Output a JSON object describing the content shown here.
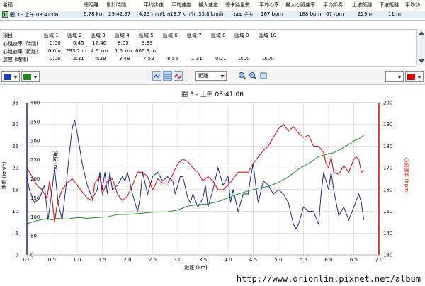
{
  "lap_table": {
    "headers": [
      "名稱",
      "總距離",
      "累計時間",
      "平均步速",
      "平均速度",
      "最大速度",
      "總卡路里數",
      "平均心率",
      "最大心跳速率",
      "平均節奏",
      "上坡距離",
      "下坡距離",
      "平均功"
    ],
    "row": [
      "圈 3 - 上午 08:41:06",
      "6.78 km",
      "29:42.97",
      "4:23 min/km",
      "13.7 km/h",
      "33.8 km/h",
      "344 千卡",
      "167 bpm",
      "188 bpm",
      "67 rpm",
      "229 m",
      "11 m",
      ""
    ]
  },
  "zone_table": {
    "headers": [
      "項目",
      "區域 1",
      "區域 2",
      "區域 3",
      "區域 4",
      "區域 5",
      "區域 6",
      "區域 7",
      "區域 8",
      "區域 9",
      "區域 10"
    ],
    "rows": [
      [
        "心跳速率 (時間)",
        "0:00",
        "0:45",
        "17:46",
        "8:05",
        "3:39",
        "",
        "",
        "",
        "",
        ""
      ],
      [
        "心跳速率 (距離)",
        "0.0 m",
        "293.2 m",
        "4.6 km",
        "1.6 km",
        "606.3 m",
        "",
        "",
        "",
        "",
        ""
      ],
      [
        "速度 (時間)",
        "0:00",
        "2:31",
        "4:29",
        "3:49",
        "7:52",
        "8:55",
        "1:31",
        "0:21",
        "0:00",
        "0:00"
      ]
    ]
  },
  "toolbar": {
    "left_color_1": "#1a3fbf",
    "left_color_2": "#1c8a1c",
    "right_color_1": "#ffffff",
    "right_color_2": "#e00000",
    "axis_select": "距離",
    "icons": [
      "chart-type-1-icon",
      "chart-type-2-icon",
      "chart-type-3-icon",
      "zoom-in-icon",
      "zoom-out-icon",
      "zoom-fit-icon"
    ]
  },
  "chart_data": {
    "type": "line",
    "title": "圈 3 - 上午 08:41:06",
    "xlabel": "距離 (km)",
    "xlim": [
      0,
      7
    ],
    "xticks": [
      "0.0",
      "0.5",
      "1.0",
      "1.5",
      "2.0",
      "2.5",
      "3.0",
      "3.5",
      "4.0",
      "4.5",
      "5.0",
      "5.5",
      "6.0",
      "6.5",
      "7.0"
    ],
    "axes": [
      {
        "label": "速度 (km/h)",
        "side": "left-outer",
        "lim": [
          0,
          35
        ],
        "ticks": [
          "0",
          "5",
          "10",
          "15",
          "20",
          "25",
          "30",
          "35"
        ],
        "color": "#1a2a8c"
      },
      {
        "label": "海拔 (m)",
        "side": "left-inner",
        "lim": [
          0,
          400
        ],
        "ticks": [
          "0",
          "50",
          "100",
          "150",
          "200",
          "250",
          "300",
          "350",
          "400"
        ],
        "color": "#1c8a1c"
      },
      {
        "label": "心跳速率 (bpm)",
        "side": "right",
        "lim": [
          130,
          200
        ],
        "ticks": [
          "130",
          "140",
          "150",
          "160",
          "170",
          "180",
          "190",
          "200"
        ],
        "color": "#e00000"
      }
    ],
    "grid": true,
    "series": [
      {
        "axis": 0,
        "color": "#1a2a8c",
        "x": [
          0.0,
          0.05,
          0.15,
          0.25,
          0.35,
          0.42,
          0.5,
          0.55,
          0.62,
          0.7,
          0.78,
          0.85,
          0.9,
          0.95,
          1.0,
          1.1,
          1.2,
          1.3,
          1.4,
          1.45,
          1.5,
          1.55,
          1.6,
          1.65,
          1.7,
          1.8,
          1.9,
          1.95,
          2.0,
          2.1,
          2.2,
          2.25,
          2.3,
          2.4,
          2.5,
          2.6,
          2.7,
          2.8,
          2.9,
          2.95,
          3.0,
          3.05,
          3.1,
          3.2,
          3.25,
          3.3,
          3.4,
          3.5,
          3.55,
          3.6,
          3.7,
          3.8,
          3.9,
          4.0,
          4.05,
          4.1,
          4.2,
          4.3,
          4.4,
          4.45,
          4.5,
          4.55,
          4.6,
          4.7,
          4.8,
          4.9,
          5.0,
          5.1,
          5.2,
          5.3,
          5.35,
          5.4,
          5.5,
          5.6,
          5.7,
          5.8,
          5.85,
          5.9,
          5.95,
          6.0,
          6.05,
          6.1,
          6.2,
          6.3,
          6.4,
          6.5,
          6.6,
          6.65,
          6.7
        ],
        "y": [
          18,
          15,
          12,
          13,
          16,
          8,
          15,
          20,
          12,
          8,
          16,
          24,
          29,
          31,
          28,
          21,
          16,
          13,
          15,
          19,
          15,
          19,
          14,
          19,
          15,
          16,
          18,
          17,
          19,
          14,
          10,
          13,
          19,
          14,
          18,
          19,
          17,
          18,
          17,
          14,
          16,
          18,
          18,
          13,
          12,
          14,
          11,
          13,
          16,
          11,
          15,
          20,
          16,
          18,
          12,
          15,
          10,
          14,
          14,
          18,
          21,
          16,
          12,
          17,
          16,
          14,
          15,
          14,
          12,
          7,
          6,
          7,
          11,
          10,
          10,
          7,
          14,
          19,
          17,
          15,
          19,
          15,
          9,
          11,
          8,
          11,
          14,
          12,
          8
        ]
      },
      {
        "axis": 1,
        "color": "#1c8a1c",
        "x": [
          0.0,
          0.2,
          0.4,
          0.5,
          0.6,
          0.8,
          1.0,
          1.2,
          1.4,
          1.6,
          1.8,
          2.0,
          2.2,
          2.5,
          2.8,
          3.0,
          3.2,
          3.4,
          3.6,
          3.8,
          4.0,
          4.2,
          4.4,
          4.6,
          4.8,
          5.0,
          5.2,
          5.4,
          5.6,
          5.8,
          6.0,
          6.1,
          6.2,
          6.4,
          6.5,
          6.6,
          6.7
        ],
        "y": [
          82,
          90,
          95,
          92,
          96,
          94,
          98,
          96,
          98,
          100,
          106,
          106,
          108,
          112,
          113,
          118,
          128,
          132,
          134,
          140,
          150,
          160,
          168,
          175,
          180,
          190,
          205,
          225,
          240,
          258,
          266,
          268,
          275,
          290,
          300,
          305,
          315
        ]
      },
      {
        "axis": 2,
        "color": "#e00000",
        "x": [
          0.0,
          0.1,
          0.2,
          0.3,
          0.4,
          0.45,
          0.5,
          0.55,
          0.6,
          0.7,
          0.8,
          0.9,
          1.0,
          1.1,
          1.2,
          1.3,
          1.35,
          1.45,
          1.5,
          1.6,
          1.7,
          1.8,
          1.9,
          2.0,
          2.1,
          2.2,
          2.3,
          2.4,
          2.5,
          2.55,
          2.6,
          2.7,
          2.8,
          2.9,
          3.0,
          3.1,
          3.2,
          3.3,
          3.4,
          3.5,
          3.6,
          3.7,
          3.8,
          3.9,
          4.0,
          4.1,
          4.2,
          4.3,
          4.4,
          4.5,
          4.6,
          4.7,
          4.8,
          4.9,
          5.0,
          5.1,
          5.2,
          5.3,
          5.4,
          5.5,
          5.6,
          5.7,
          5.8,
          5.9,
          5.95,
          6.0,
          6.05,
          6.1,
          6.2,
          6.3,
          6.4,
          6.5,
          6.55,
          6.6,
          6.65,
          6.7
        ],
        "y": [
          170,
          166,
          162,
          160,
          156,
          164,
          156,
          145,
          153,
          160,
          163,
          165,
          162,
          159,
          156,
          155,
          163,
          166,
          158,
          164,
          165,
          158,
          155,
          157,
          162,
          168,
          168,
          166,
          160,
          162,
          165,
          163,
          163,
          167,
          172,
          174,
          173,
          170,
          168,
          164,
          166,
          164,
          160,
          160,
          162,
          165,
          168,
          168,
          168,
          172,
          175,
          178,
          180,
          184,
          188,
          190,
          187,
          189,
          186,
          184,
          185,
          180,
          180,
          177,
          172,
          170,
          175,
          168,
          167,
          171,
          168,
          174,
          175,
          174,
          168,
          169
        ]
      }
    ]
  },
  "watermark": "http://www.orionlin.pixnet.net/album"
}
